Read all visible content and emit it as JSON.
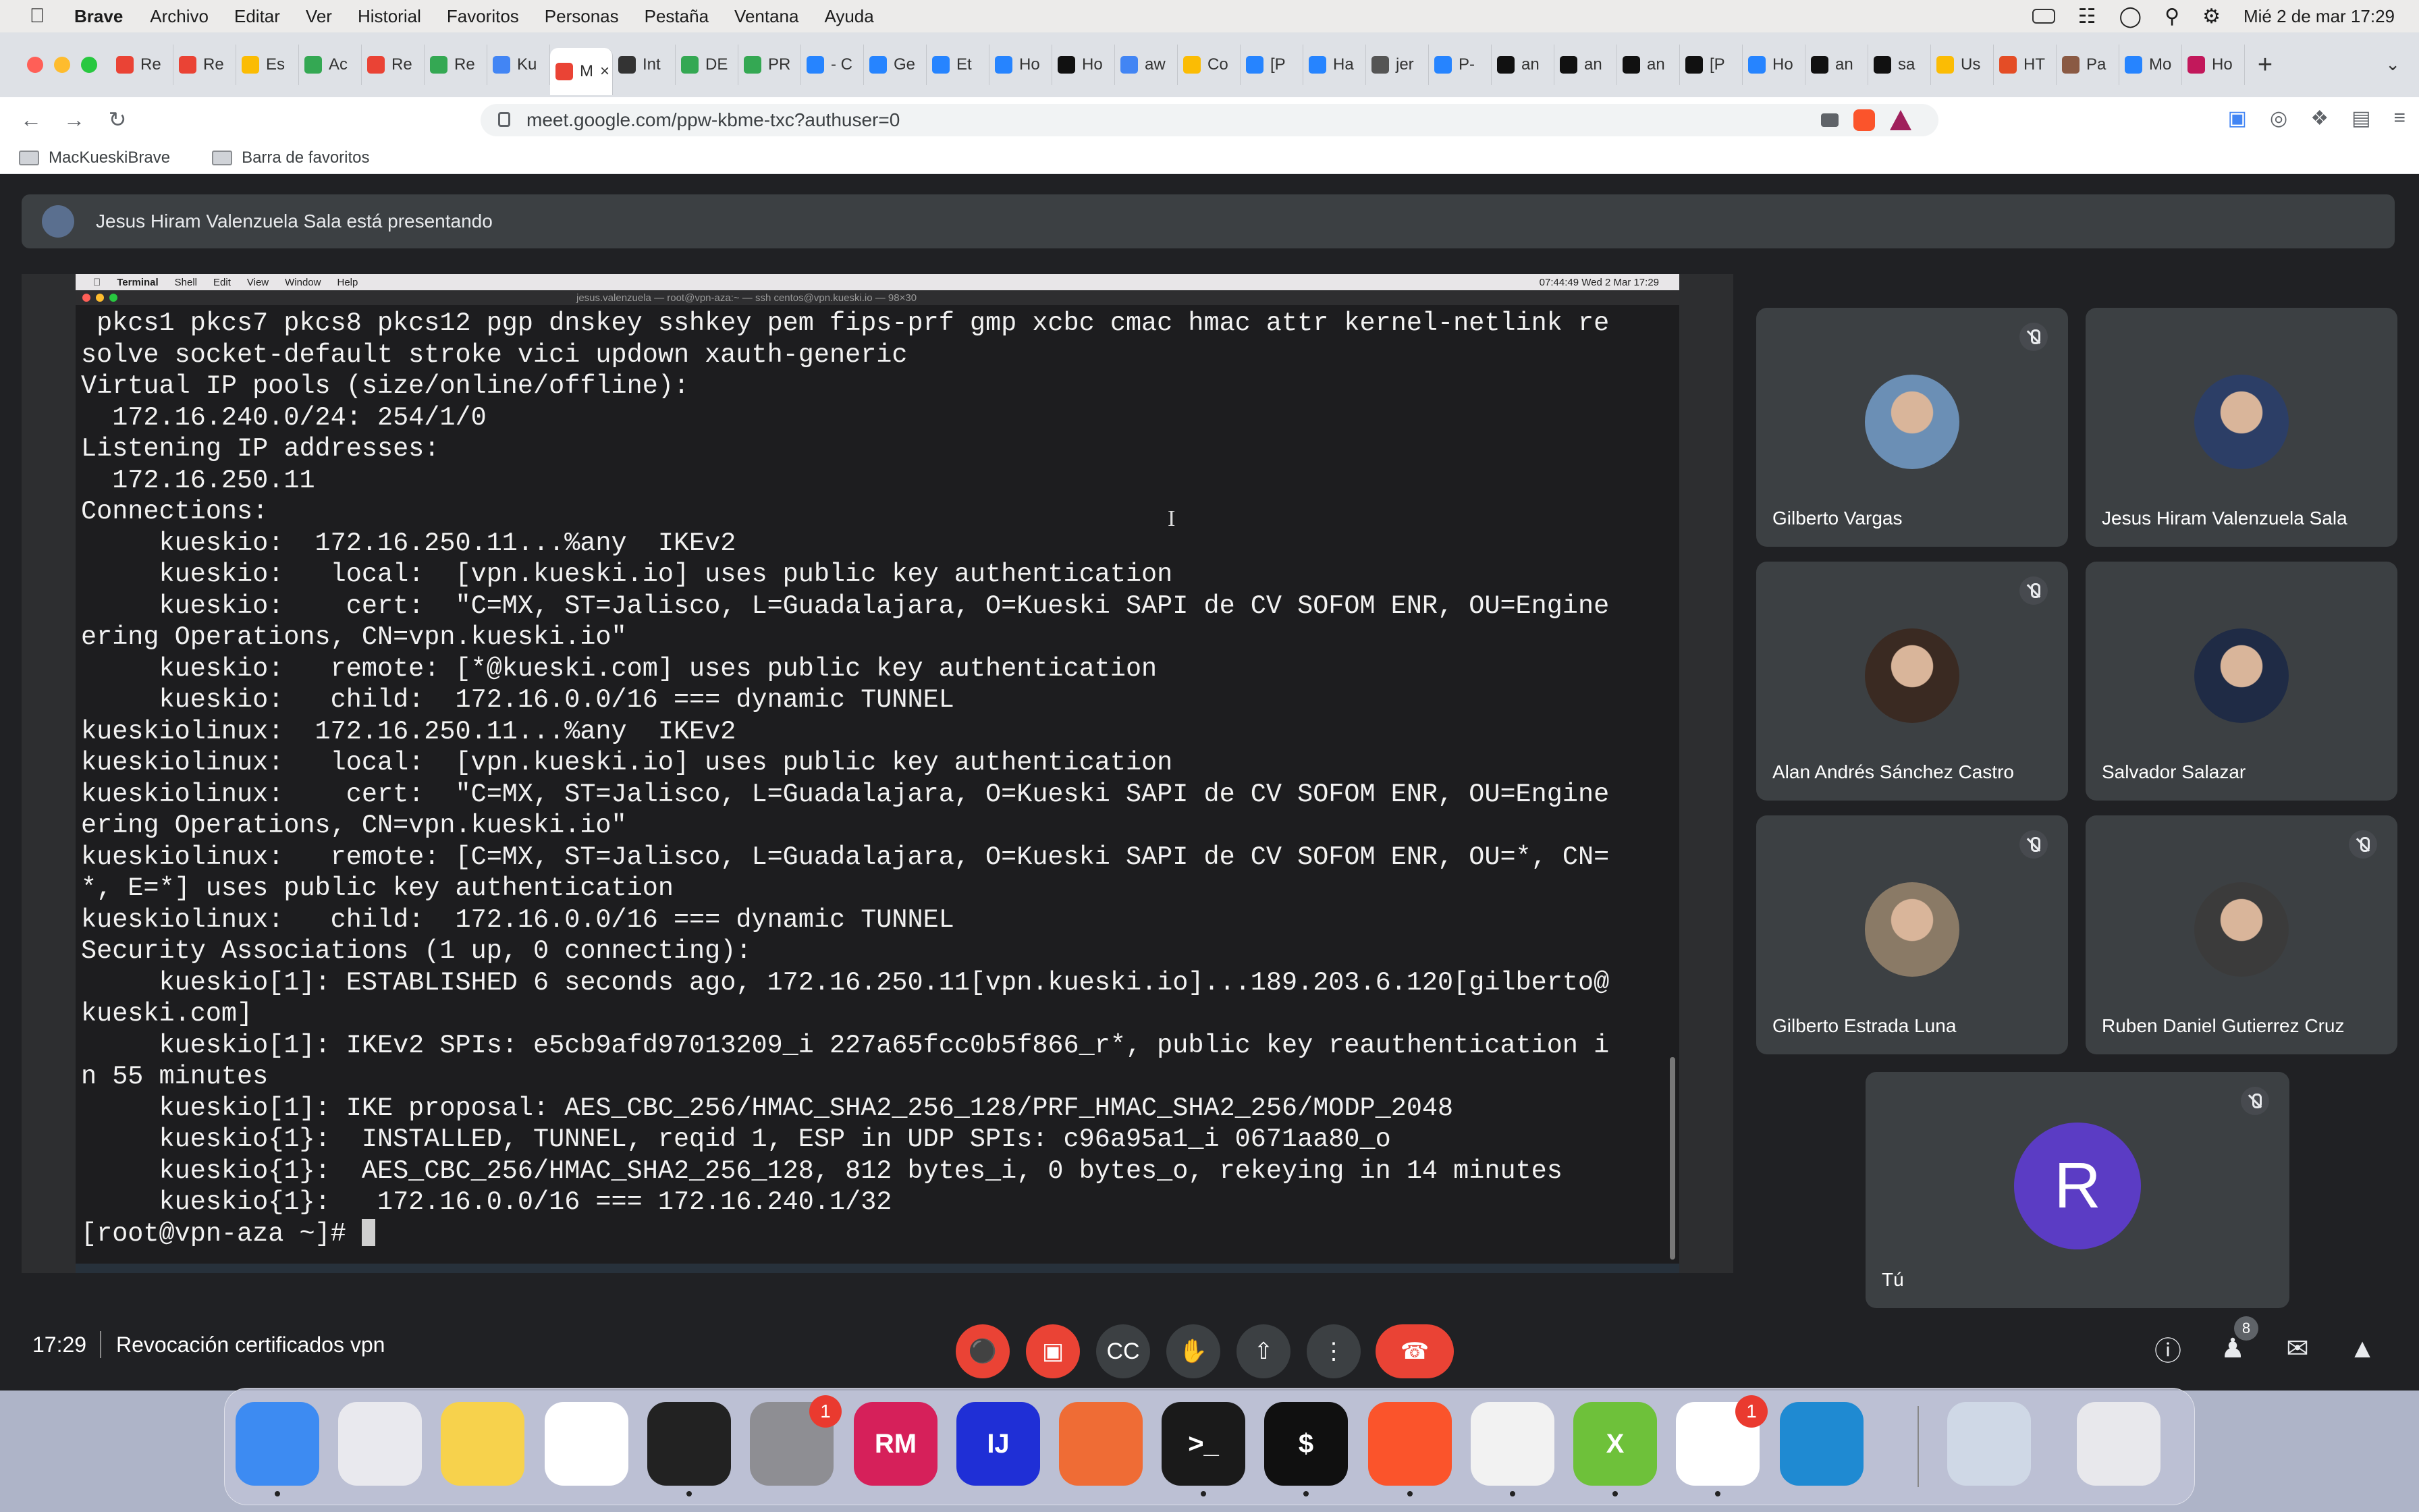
{
  "system_bar": {
    "app_name": "Brave",
    "menus": [
      "Archivo",
      "Editar",
      "Ver",
      "Historial",
      "Favoritos",
      "Personas",
      "Pestaña",
      "Ventana",
      "Ayuda"
    ],
    "datetime": "Mié 2 de mar  17:29"
  },
  "browser": {
    "tabs": [
      {
        "label": "Re",
        "color": "#ea4335"
      },
      {
        "label": "Re",
        "color": "#ea4335"
      },
      {
        "label": "Es",
        "color": "#fbbc04"
      },
      {
        "label": "Ac",
        "color": "#34a853"
      },
      {
        "label": "Re",
        "color": "#ea4335"
      },
      {
        "label": "Re",
        "color": "#34a853"
      },
      {
        "label": "Ku",
        "color": "#4285f4"
      },
      {
        "label": "M",
        "color": "#ea4335"
      },
      {
        "label": "Int",
        "color": "#333333"
      },
      {
        "label": "DE",
        "color": "#34a853"
      },
      {
        "label": "PR",
        "color": "#34a853"
      },
      {
        "label": "- C",
        "color": "#2684ff"
      },
      {
        "label": "Ge",
        "color": "#2684ff"
      },
      {
        "label": "Et",
        "color": "#2684ff"
      },
      {
        "label": "Ho",
        "color": "#2684ff"
      },
      {
        "label": "Ho",
        "color": "#111111"
      },
      {
        "label": "aw",
        "color": "#4285f4"
      },
      {
        "label": "Co",
        "color": "#fbbc04"
      },
      {
        "label": "[P",
        "color": "#2684ff"
      },
      {
        "label": "Ha",
        "color": "#2684ff"
      },
      {
        "label": "jer",
        "color": "#555555"
      },
      {
        "label": "P-",
        "color": "#2684ff"
      },
      {
        "label": "an",
        "color": "#111111"
      },
      {
        "label": "an",
        "color": "#111111"
      },
      {
        "label": "an",
        "color": "#111111"
      },
      {
        "label": "[P",
        "color": "#111111"
      },
      {
        "label": "Ho",
        "color": "#2684ff"
      },
      {
        "label": "an",
        "color": "#111111"
      },
      {
        "label": "sa",
        "color": "#111111"
      },
      {
        "label": "Us",
        "color": "#fbbc04"
      },
      {
        "label": "HT",
        "color": "#e44d26"
      },
      {
        "label": "Pa",
        "color": "#8a5a44"
      },
      {
        "label": "Mo",
        "color": "#2684ff"
      },
      {
        "label": "Ho",
        "color": "#c2185b"
      }
    ],
    "active_tab_index": 7,
    "url": "meet.google.com/ppw-kbme-txc?authuser=0",
    "bookmarks": [
      "MacKueskiBrave",
      "Barra de favoritos"
    ]
  },
  "meet": {
    "presenting_banner": "Jesus Hiram Valenzuela Sala está presentando",
    "terminal": {
      "menubar": [
        "Terminal",
        "Shell",
        "Edit",
        "View",
        "Window",
        "Help"
      ],
      "menubar_right": "07:44:49      Wed 2 Mar  17:29",
      "window_title": "jesus.valenzuela — root@vpn-aza:~ — ssh centos@vpn.kueski.io — 98×30",
      "lines": [
        " pkcs1 pkcs7 pkcs8 pkcs12 pgp dnskey sshkey pem fips-prf gmp xcbc cmac hmac attr kernel-netlink re",
        "solve socket-default stroke vici updown xauth-generic",
        "Virtual IP pools (size/online/offline):",
        "  172.16.240.0/24: 254/1/0",
        "Listening IP addresses:",
        "  172.16.250.11",
        "Connections:",
        "     kueskio:  172.16.250.11...%any  IKEv2",
        "     kueskio:   local:  [vpn.kueski.io] uses public key authentication",
        "     kueskio:    cert:  \"C=MX, ST=Jalisco, L=Guadalajara, O=Kueski SAPI de CV SOFOM ENR, OU=Engine",
        "ering Operations, CN=vpn.kueski.io\"",
        "     kueskio:   remote: [*@kueski.com] uses public key authentication",
        "     kueskio:   child:  172.16.0.0/16 === dynamic TUNNEL",
        "kueskiolinux:  172.16.250.11...%any  IKEv2",
        "kueskiolinux:   local:  [vpn.kueski.io] uses public key authentication",
        "kueskiolinux:    cert:  \"C=MX, ST=Jalisco, L=Guadalajara, O=Kueski SAPI de CV SOFOM ENR, OU=Engine",
        "ering Operations, CN=vpn.kueski.io\"",
        "kueskiolinux:   remote: [C=MX, ST=Jalisco, L=Guadalajara, O=Kueski SAPI de CV SOFOM ENR, OU=*, CN=",
        "*, E=*] uses public key authentication",
        "kueskiolinux:   child:  172.16.0.0/16 === dynamic TUNNEL",
        "Security Associations (1 up, 0 connecting):",
        "     kueskio[1]: ESTABLISHED 6 seconds ago, 172.16.250.11[vpn.kueski.io]...189.203.6.120[gilberto@",
        "kueski.com]",
        "     kueskio[1]: IKEv2 SPIs: e5cb9afd97013209_i 227a65fcc0b5f866_r*, public key reauthentication i",
        "n 55 minutes",
        "     kueskio[1]: IKE proposal: AES_CBC_256/HMAC_SHA2_256_128/PRF_HMAC_SHA2_256/MODP_2048",
        "     kueskio{1}:  INSTALLED, TUNNEL, reqid 1, ESP in UDP SPIs: c96a95a1_i 0671aa80_o",
        "     kueskio{1}:  AES_CBC_256/HMAC_SHA2_256_128, 812 bytes_i, 0 bytes_o, rekeying in 14 minutes",
        "     kueskio{1}:   172.16.0.0/16 === 172.16.240.1/32"
      ],
      "prompt": "[root@vpn-aza ~]# "
    },
    "participants": [
      {
        "name": "Gilberto Vargas",
        "muted": true,
        "avatar_color": "#6b8fb5"
      },
      {
        "name": "Jesus Hiram Valenzuela Sala",
        "muted": false,
        "avatar_color": "#2c3e66"
      },
      {
        "name": "Alan Andrés Sánchez Castro",
        "muted": true,
        "avatar_color": "#3a2a22"
      },
      {
        "name": "Salvador Salazar",
        "muted": false,
        "avatar_color": "#1f2b45"
      },
      {
        "name": "Gilberto Estrada Luna",
        "muted": true,
        "avatar_color": "#8a7a66"
      },
      {
        "name": "Ruben Daniel Gutierrez Cruz",
        "muted": true,
        "avatar_color": "#3b3b3b"
      }
    ],
    "self_tile": {
      "name": "Tú",
      "initial": "R",
      "muted": true
    },
    "meeting_time": "17:29",
    "meeting_title": "Revocación certificados vpn",
    "participant_count": "8"
  },
  "dock": {
    "apps": [
      {
        "name": "Finder",
        "color": "#3d8bf2",
        "label": "",
        "badge": ""
      },
      {
        "name": "Launchpad",
        "color": "#e9e9ee",
        "label": "",
        "badge": ""
      },
      {
        "name": "Notes",
        "color": "#f7d24c",
        "label": "",
        "badge": ""
      },
      {
        "name": "Reminders",
        "color": "#ffffff",
        "label": "",
        "badge": ""
      },
      {
        "name": "Activity Monitor",
        "color": "#222222",
        "label": "",
        "badge": ""
      },
      {
        "name": "System Preferences",
        "color": "#8e8e93",
        "label": "",
        "badge": "1"
      },
      {
        "name": "RubyMine",
        "color": "#d6205a",
        "label": "RM",
        "badge": ""
      },
      {
        "name": "IntelliJ IDEA",
        "color": "#1f2fd6",
        "label": "IJ",
        "badge": ""
      },
      {
        "name": "Postman",
        "color": "#ef6c35",
        "label": "",
        "badge": ""
      },
      {
        "name": "Terminal",
        "color": "#1a1a1a",
        "label": ">_",
        "badge": ""
      },
      {
        "name": "iTerm",
        "color": "#101010",
        "label": "$",
        "badge": ""
      },
      {
        "name": "Brave",
        "color": "#fb542b",
        "label": "",
        "badge": ""
      },
      {
        "name": "Chrome",
        "color": "#f2f2f2",
        "label": "",
        "badge": ""
      },
      {
        "name": "XMind",
        "color": "#6ec13a",
        "label": "X",
        "badge": ""
      },
      {
        "name": "Slack",
        "color": "#ffffff",
        "label": "",
        "badge": "1"
      },
      {
        "name": "VS Code",
        "color": "#1f8ad2",
        "label": "",
        "badge": ""
      },
      {
        "name": "Preview",
        "color": "#cfd8e6",
        "label": "",
        "badge": ""
      },
      {
        "name": "Trash",
        "color": "#e8e8ec",
        "label": "",
        "badge": ""
      }
    ]
  }
}
